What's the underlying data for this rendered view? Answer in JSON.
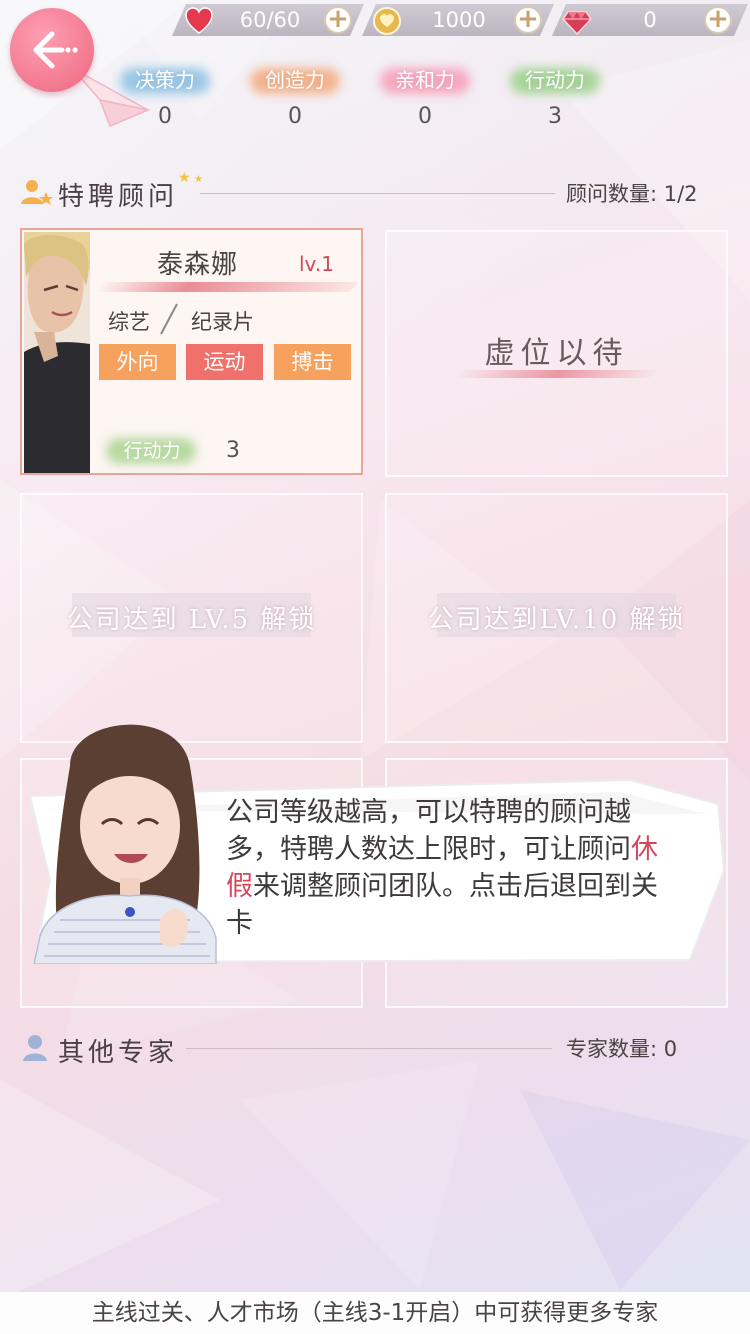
{
  "resources": {
    "stamina": {
      "value": "60/60",
      "icon": "heart-icon",
      "color": "#e5394d"
    },
    "gold": {
      "value": "1000",
      "icon": "gold-coin-icon",
      "color": "#e8b84a"
    },
    "diamond": {
      "value": "0",
      "icon": "diamond-icon",
      "color": "#d63d56"
    }
  },
  "stats": [
    {
      "label": "决策力",
      "value": "0",
      "glow": "#9bc8e6"
    },
    {
      "label": "创造力",
      "value": "0",
      "glow": "#f4b48f"
    },
    {
      "label": "亲和力",
      "value": "0",
      "glow": "#f7a8bf"
    },
    {
      "label": "行动力",
      "value": "3",
      "glow": "#a8d59a"
    }
  ],
  "advisors_section": {
    "title": "特聘顾问",
    "count_label": "顾问数量: 1/2"
  },
  "advisor": {
    "name": "泰森娜",
    "level": "lv.1",
    "genre_1": "综艺",
    "genre_2": "纪录片",
    "tags": [
      {
        "label": "外向",
        "color": "#f7a15f"
      },
      {
        "label": "运动",
        "color": "#f0716c"
      },
      {
        "label": "搏击",
        "color": "#f7a15f"
      }
    ],
    "stat_label": "行动力",
    "stat_value": "3"
  },
  "slots": {
    "vacant": "虚位以待",
    "lock_lv5": "公司达到 LV.5 解锁",
    "lock_lv10": "公司达到LV.10 解锁"
  },
  "dialog": {
    "text_before": "公司等级越高，可以特聘的顾问越多，特聘人数达上限时，可让顾问",
    "highlight": "休假",
    "text_after": "来调整顾问团队。点击后退回到关卡"
  },
  "experts_section": {
    "title": "其他专家",
    "count_label": "专家数量: 0"
  },
  "bottom_hint": "主线过关、人才市场（主线3-1开启）中可获得更多专家"
}
